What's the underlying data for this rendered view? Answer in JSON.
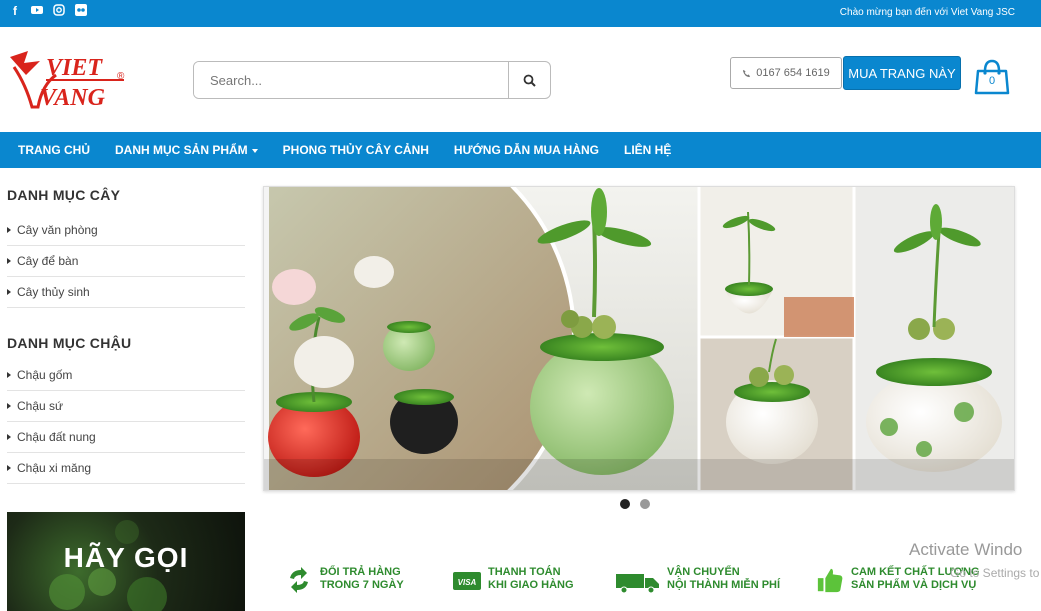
{
  "topbar": {
    "social_icons": [
      "facebook-icon",
      "youtube-icon",
      "instagram-icon",
      "flickr-icon"
    ],
    "welcome": "Chào mừng bạn đến với Viet Vang JSC"
  },
  "header": {
    "logo_top": "VIET",
    "logo_bottom": "VANG",
    "logo_mark": "®",
    "search": {
      "placeholder": "Search...",
      "value": ""
    },
    "phone": "0167 654 1619",
    "buy_label": "MUA TRANG NÀY",
    "cart_count": "0"
  },
  "nav": {
    "items": [
      {
        "label": "TRANG CHỦ"
      },
      {
        "label": "DANH MỤC SẢN PHẨM"
      },
      {
        "label": "PHONG THỦY CÂY CẢNH"
      },
      {
        "label": "HƯỚNG DẪN MUA HÀNG"
      },
      {
        "label": "LIÊN HỆ"
      }
    ]
  },
  "sidebar": {
    "tree_title": "DANH MỤC CÂY",
    "tree_items": [
      "Cây văn phòng",
      "Cây để bàn",
      "Cây thủy sinh"
    ],
    "pot_title": "DANH MỤC CHẬU",
    "pot_items": [
      "Chậu gốm",
      "Chậu sứ",
      "Chậu đất nung",
      "Chậu xi măng"
    ],
    "promo_text": "HÃY GỌI"
  },
  "slider": {
    "slide_count": 2,
    "active_index": 0
  },
  "features": [
    {
      "line1": "ĐỔI TRẢ HÀNG",
      "line2": "TRONG 7 NGÀY",
      "icon": "return-arrows-icon"
    },
    {
      "line1": "THANH TOÁN",
      "line2": "KHI GIAO HÀNG",
      "icon": "visa-card-icon"
    },
    {
      "line1": "VẬN CHUYỂN",
      "line2": "NỘI THÀNH MIỄN PHÍ",
      "icon": "delivery-truck-icon"
    },
    {
      "line1": "CAM KẾT CHẤT LƯỢNG",
      "line2": "SẢN PHẨM VÀ DỊCH VỤ",
      "icon": "thumbs-up-icon"
    }
  ],
  "watermark": {
    "line1": "Activate Windo",
    "line2": "Go to Settings to act"
  },
  "colors": {
    "brand_blue": "#0a87cf",
    "logo_red": "#d9241c",
    "feature_green": "#2e8b2e"
  }
}
